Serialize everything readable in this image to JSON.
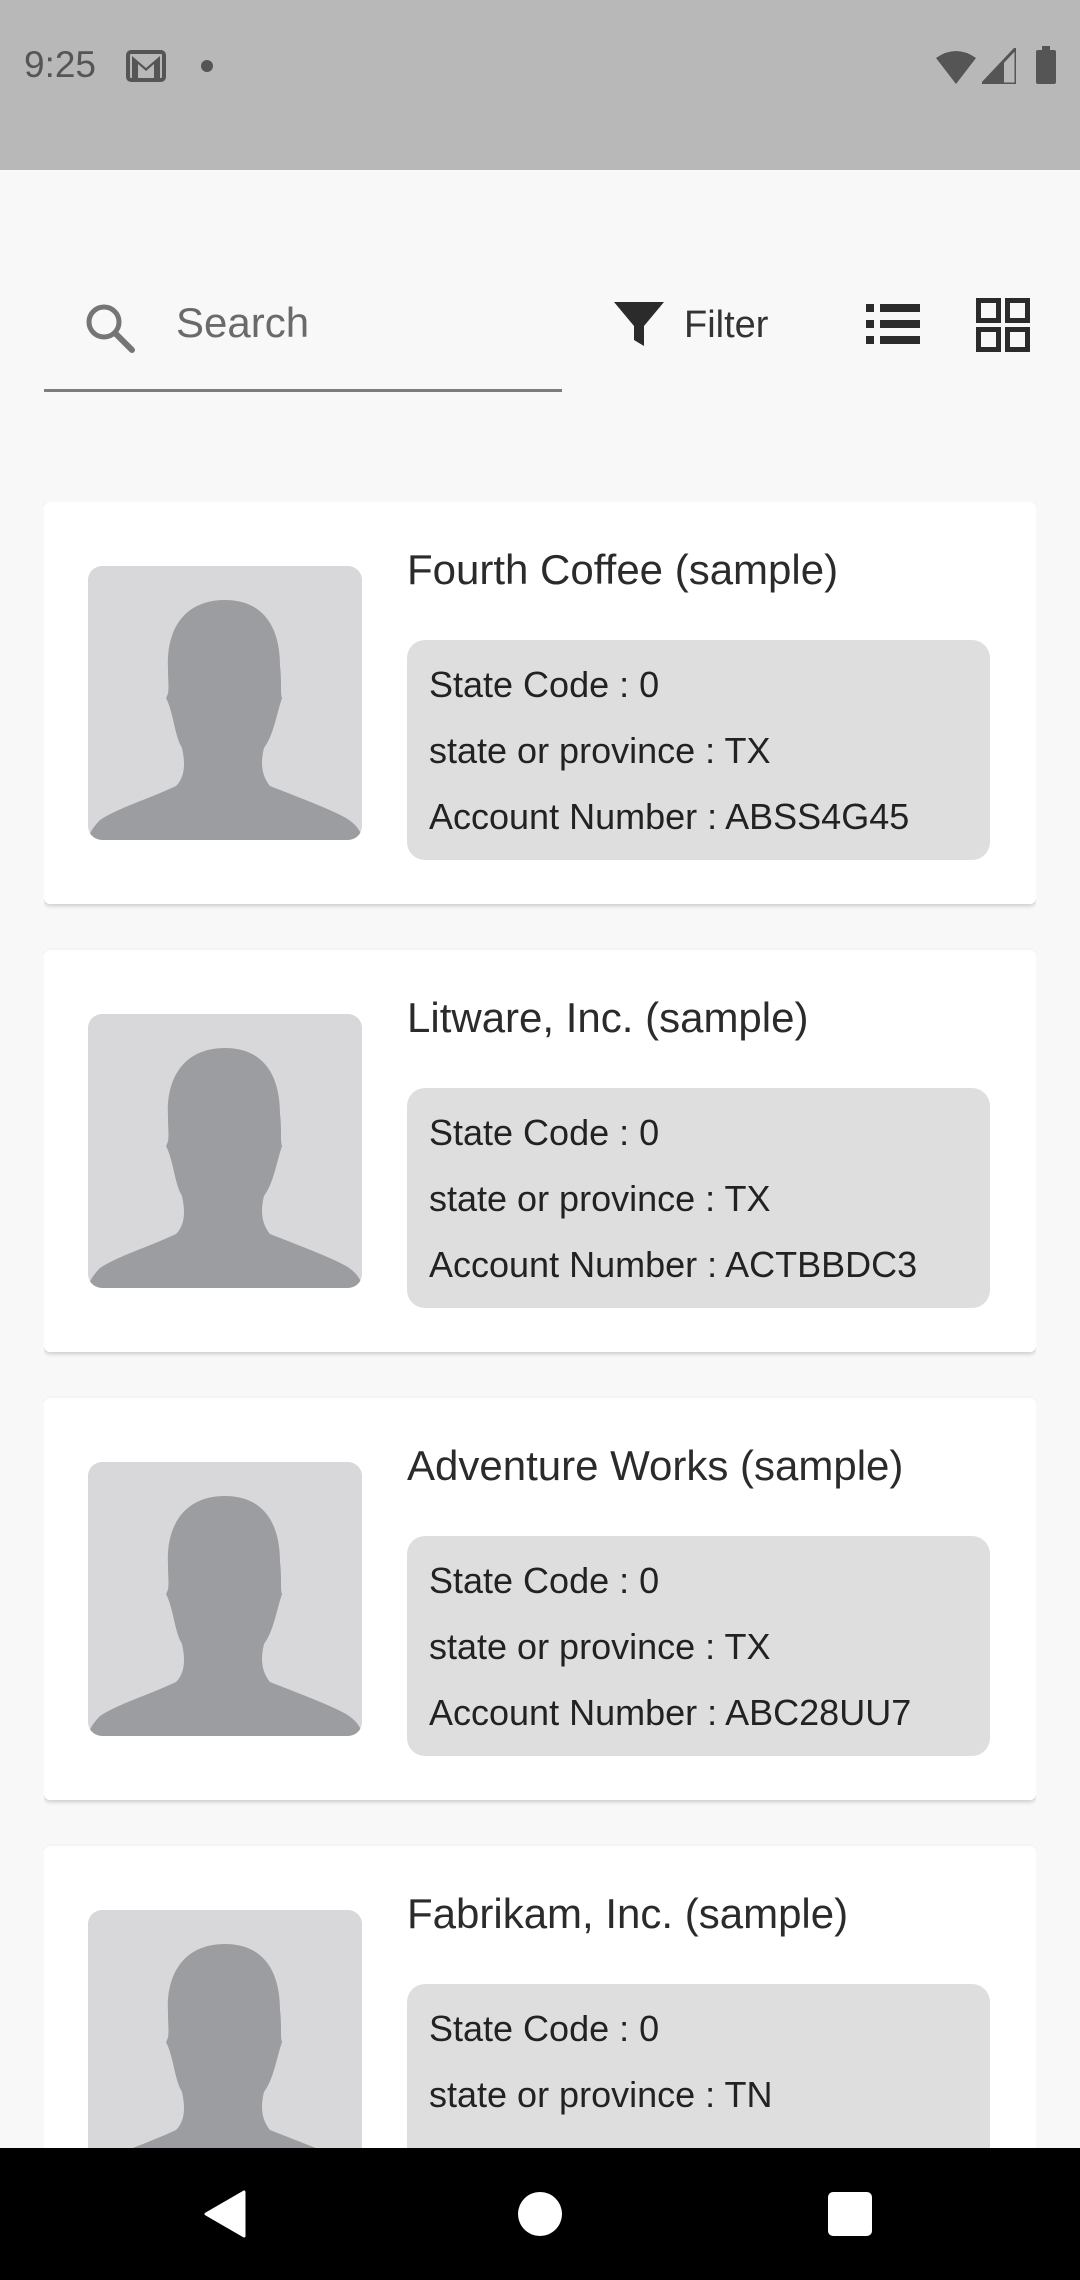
{
  "status_bar": {
    "time": "9:25",
    "icons": [
      "gmail-icon",
      "notification-dot",
      "wifi-icon",
      "signal-icon",
      "battery-icon"
    ]
  },
  "toolbar": {
    "search_placeholder": "Search",
    "search_value": "",
    "filter_label": "Filter",
    "icons": [
      "search-icon",
      "filter-icon",
      "list-view-icon",
      "grid-view-icon"
    ]
  },
  "records": [
    {
      "name": "Fourth Coffee (sample)",
      "line1": "State Code : 0",
      "line2": "state or province : TX",
      "line3": "Account Number : ABSS4G45"
    },
    {
      "name": "Litware, Inc. (sample)",
      "line1": "State Code : 0",
      "line2": "state or province : TX",
      "line3": "Account Number : ACTBBDC3"
    },
    {
      "name": "Adventure Works (sample)",
      "line1": "State Code : 0",
      "line2": "state or province : TX",
      "line3": "Account Number : ABC28UU7"
    },
    {
      "name": "Fabrikam, Inc. (sample)",
      "line1": "State Code : 0",
      "line2": "state or province : TN",
      "line3": ""
    }
  ],
  "nav_bar": {
    "icons": [
      "back-icon",
      "home-icon",
      "recents-icon"
    ]
  },
  "colors": {
    "status_bar": "#b8b8b8",
    "background": "#f8f8f8",
    "card": "#ffffff",
    "details_box": "#dedede",
    "avatar_bg": "#d8d8da",
    "avatar_silhouette": "#9c9da0"
  }
}
